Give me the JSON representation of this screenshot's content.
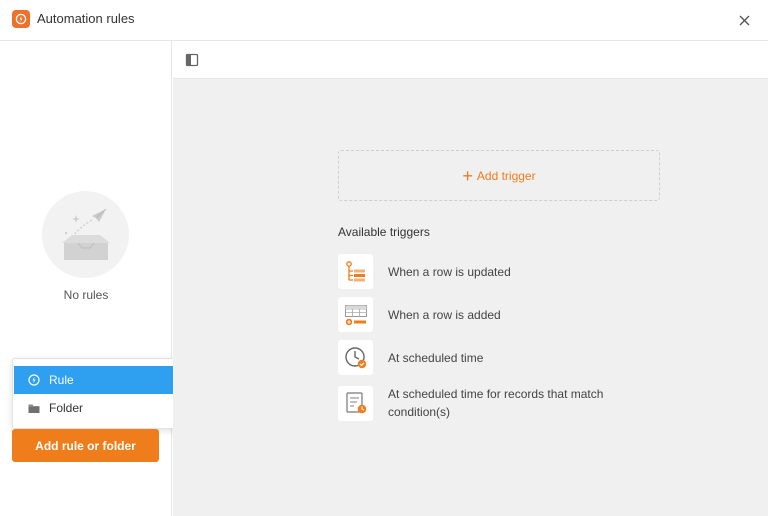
{
  "window": {
    "title": "Automation rules"
  },
  "left_panel": {
    "empty_text": "No rules",
    "menu": {
      "items": [
        {
          "label": "Rule",
          "icon": "lightning-icon"
        },
        {
          "label": "Folder",
          "icon": "folder-icon"
        }
      ]
    },
    "add_button_label": "Add rule or folder"
  },
  "main": {
    "add_trigger_label": "Add trigger",
    "available_title": "Available triggers",
    "triggers": [
      {
        "label": "When a row is updated",
        "icon": "row-updated-icon"
      },
      {
        "label": "When a row is added",
        "icon": "row-added-icon"
      },
      {
        "label": "At scheduled time",
        "icon": "clock-icon"
      },
      {
        "label": "At scheduled time for records that match condition(s)",
        "icon": "scheduled-condition-icon"
      }
    ]
  },
  "colors": {
    "accent_orange": "#ef7d1b",
    "menu_active_blue": "#2f9ff0",
    "panel_gray": "#f0f0f0"
  }
}
